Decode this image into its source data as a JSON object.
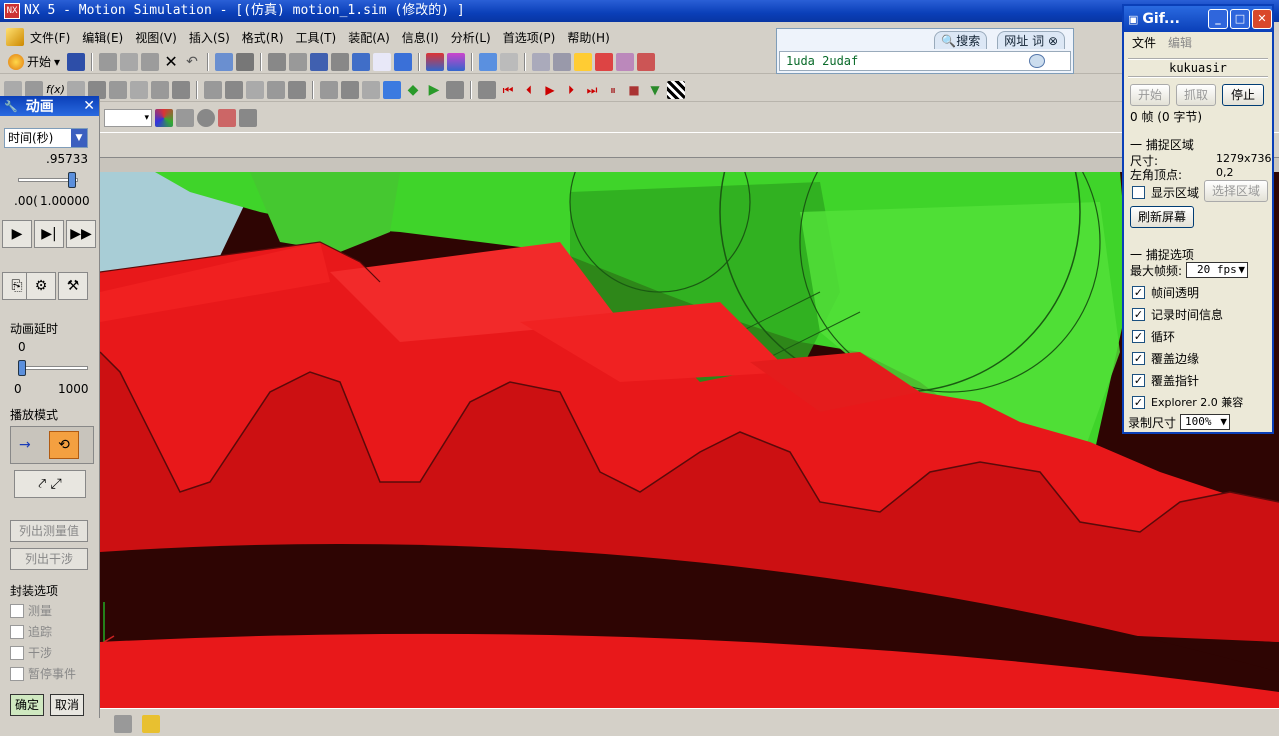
{
  "window": {
    "title": "NX 5 - Motion Simulation - [(仿真) motion_1.sim (修改的) ]"
  },
  "menu": [
    "文件(F)",
    "编辑(E)",
    "视图(V)",
    "插入(S)",
    "格式(R)",
    "工具(T)",
    "装配(A)",
    "信息(I)",
    "分析(L)",
    "首选项(P)",
    "帮助(H)"
  ],
  "toolbar": {
    "start_label": "开始"
  },
  "search": {
    "tab_search": "搜索",
    "tab_web": "网址",
    "tab_word": "词",
    "value": "1uda 2udaf"
  },
  "anim": {
    "title": "动画",
    "time_select": "时间(秒)",
    "time_value": ".95733",
    "range_min": ".00(",
    "range_max": "1.00000",
    "delay_label": "动画延时",
    "delay_value": "0",
    "delay_min": "0",
    "delay_max": "1000",
    "delay_level": 0,
    "time_level": 0.957,
    "play_mode_label": "播放模式",
    "list_measure": "列出测量值",
    "list_interference": "列出干涉",
    "package_label": "封装选项",
    "opt_measure": "测量",
    "opt_trace": "追踪",
    "opt_interference": "干涉",
    "opt_pause": "暂停事件",
    "ok": "确定",
    "cancel": "取消"
  },
  "gif": {
    "title": "Gif...",
    "menu_file": "文件",
    "menu_edit": "编辑",
    "user": "kukuasir",
    "btn_start": "开始",
    "btn_capture": "抓取",
    "btn_stop": "停止",
    "frames": "0 帧 (0 字节)",
    "capture_area": "一 捕捉区域",
    "size_label": "尺寸:",
    "size_value": "1279x736",
    "corner_label": "左角顶点:",
    "corner_value": "0,2",
    "show_area": "显示区域",
    "select_area": "选择区域",
    "refresh": "刷新屏幕",
    "capture_opts": "一 捕捉选项",
    "max_fps_label": "最大帧频:",
    "max_fps_value": "20 fps",
    "opt1": "帧间透明",
    "opt2": "记录时间信息",
    "opt3": "循环",
    "opt4": "覆盖边缘",
    "opt5": "覆盖指针",
    "opt6": "Explorer 2.0 兼容",
    "rec_size_label": "录制尺寸",
    "rec_size_value": "100%"
  },
  "colors": {
    "gear_red": "#e8181a",
    "gear_green": "#3fd42a",
    "shadow": "#2e0503"
  }
}
